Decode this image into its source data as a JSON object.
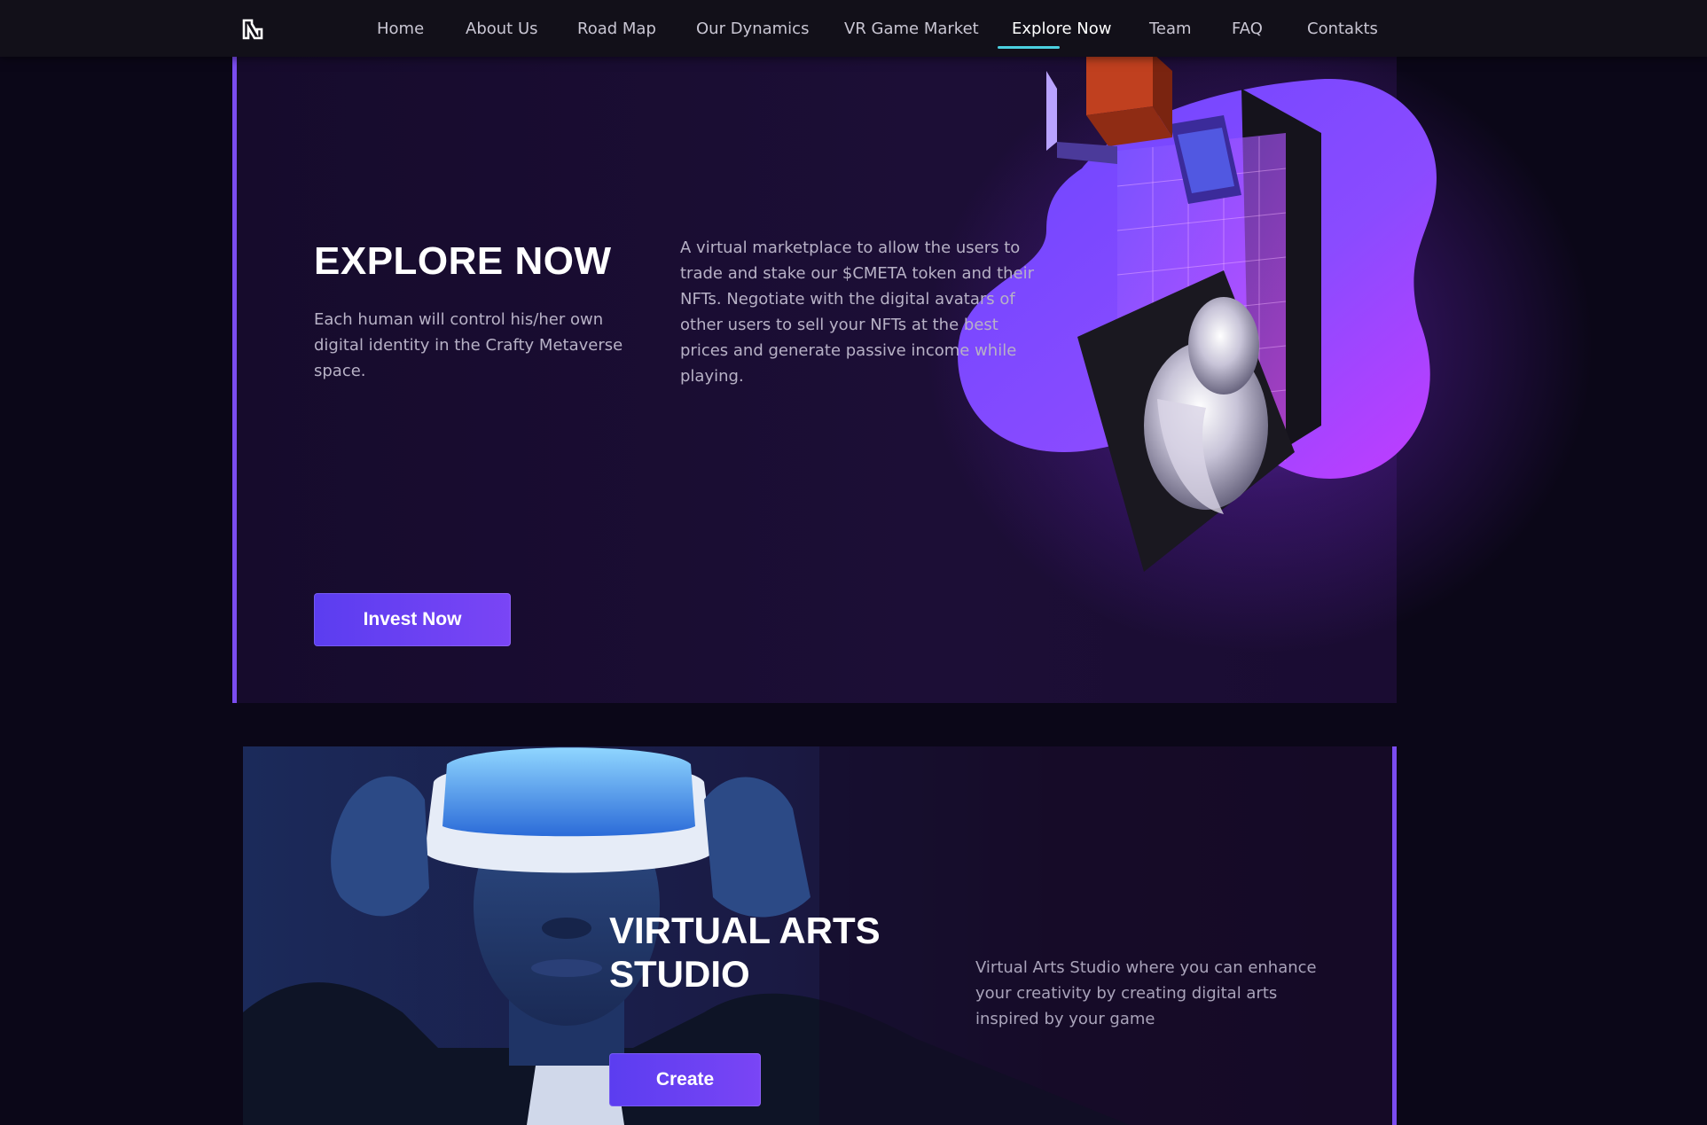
{
  "nav": {
    "items": [
      {
        "label": "Home"
      },
      {
        "label": "About Us"
      },
      {
        "label": "Road Map"
      },
      {
        "label": "Our Dynamics"
      },
      {
        "label": "VR Game Market"
      },
      {
        "label": "Explore Now"
      },
      {
        "label": "Team"
      },
      {
        "label": "FAQ"
      },
      {
        "label": "Contakts"
      }
    ],
    "active_item": "Explore Now"
  },
  "explore": {
    "title": "EXPLORE NOW",
    "subtitle": "Each human will control his/her own digital identity in the Crafty Metaverse space.",
    "description": "A virtual marketplace to allow the users to trade and stake our $CMETA token and their NFTs. Negotiate with the digital avatars of other users to sell your NFTs at the best prices and generate passive income while playing.",
    "button_label": "Invest Now"
  },
  "studio": {
    "title_line1": "VIRTUAL ARTS",
    "title_line2": "STUDIO",
    "description": "Virtual Arts Studio where you can enhance your creativity by creating digital arts inspired by your game",
    "button_label": "Create"
  },
  "colors": {
    "accent": "#7b4cf0",
    "button": "#5b3df0",
    "nav_underline": "#4bd0e0",
    "background": "#0b0718"
  },
  "icons": {
    "logo": "brand-logo-icon"
  }
}
